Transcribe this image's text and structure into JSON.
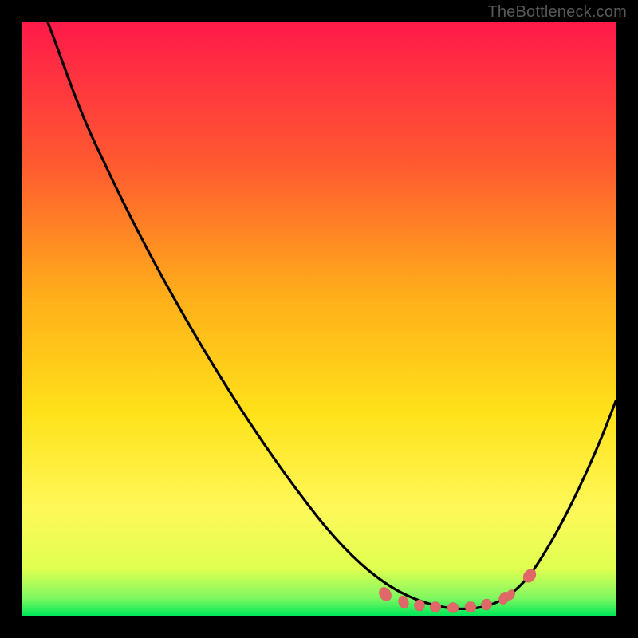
{
  "watermark": "TheBottleneck.com",
  "chart_data": {
    "type": "line",
    "title": "",
    "xlabel": "",
    "ylabel": "",
    "xlim": [
      0,
      100
    ],
    "ylim": [
      0,
      100
    ],
    "x": [
      0,
      5,
      10,
      15,
      20,
      25,
      30,
      35,
      40,
      45,
      50,
      55,
      60,
      65,
      70,
      75,
      80,
      85,
      90,
      95,
      100
    ],
    "values": [
      100,
      99,
      96,
      91,
      84,
      76,
      67,
      58,
      49,
      40,
      31,
      23,
      15,
      9,
      4,
      1,
      0,
      2,
      8,
      18,
      32
    ],
    "gradient_colors": {
      "top": "#ff1a4a",
      "upper_mid": "#ff7a2a",
      "mid": "#ffd31a",
      "lower_mid": "#fff860",
      "near_bottom": "#d8ff3a",
      "bottom": "#00e85a"
    },
    "curve_color": "#000000",
    "marker_color": "#e66a6a",
    "markers_x": [
      62,
      64,
      66,
      68,
      70,
      73,
      75,
      77,
      80,
      83
    ],
    "annotations": []
  }
}
